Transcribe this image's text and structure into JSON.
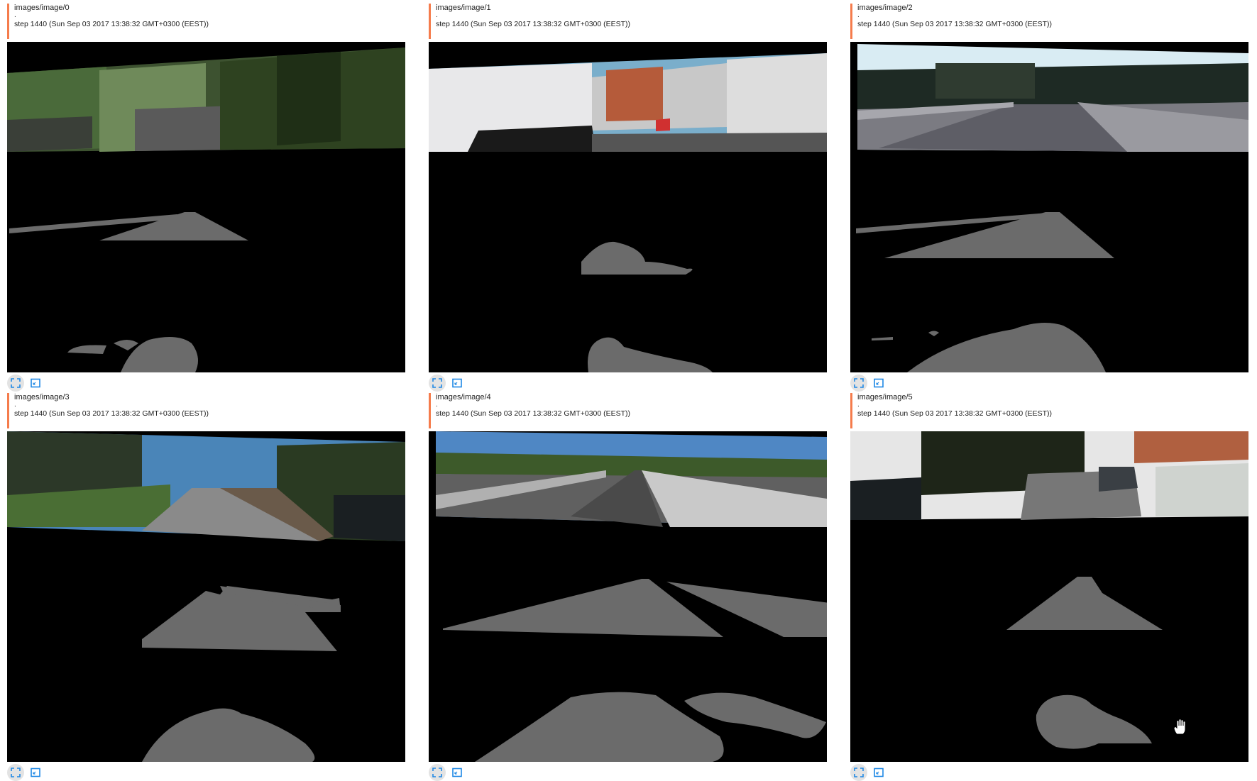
{
  "cards": [
    {
      "tag": "images/image/0",
      "dot": ".",
      "step": "step 1440 (Sun Sep 03 2017 13:38:32 GMT+0300 (EEST))"
    },
    {
      "tag": "images/image/1",
      "dot": ".",
      "step": "step 1440 (Sun Sep 03 2017 13:38:32 GMT+0300 (EEST))"
    },
    {
      "tag": "images/image/2",
      "dot": ".",
      "step": "step 1440 (Sun Sep 03 2017 13:38:32 GMT+0300 (EEST))"
    },
    {
      "tag": "images/image/3",
      "dot": ".",
      "step": "step 1440 (Sun Sep 03 2017 13:38:32 GMT+0300 (EEST))"
    },
    {
      "tag": "images/image/4",
      "dot": ".",
      "step": "step 1440 (Sun Sep 03 2017 13:38:32 GMT+0300 (EEST))"
    },
    {
      "tag": "images/image/5",
      "dot": ".",
      "step": "step 1440 (Sun Sep 03 2017 13:38:32 GMT+0300 (EEST))"
    }
  ],
  "icons": {
    "fullscreen": "fullscreen-icon",
    "fit": "fit-to-screen-icon",
    "cursor": "hand-cursor-icon"
  },
  "colors": {
    "accent": "#f57c4c",
    "icon_blue": "#1e88e5",
    "mask_gray": "#6b6b6b",
    "background": "#000000"
  }
}
